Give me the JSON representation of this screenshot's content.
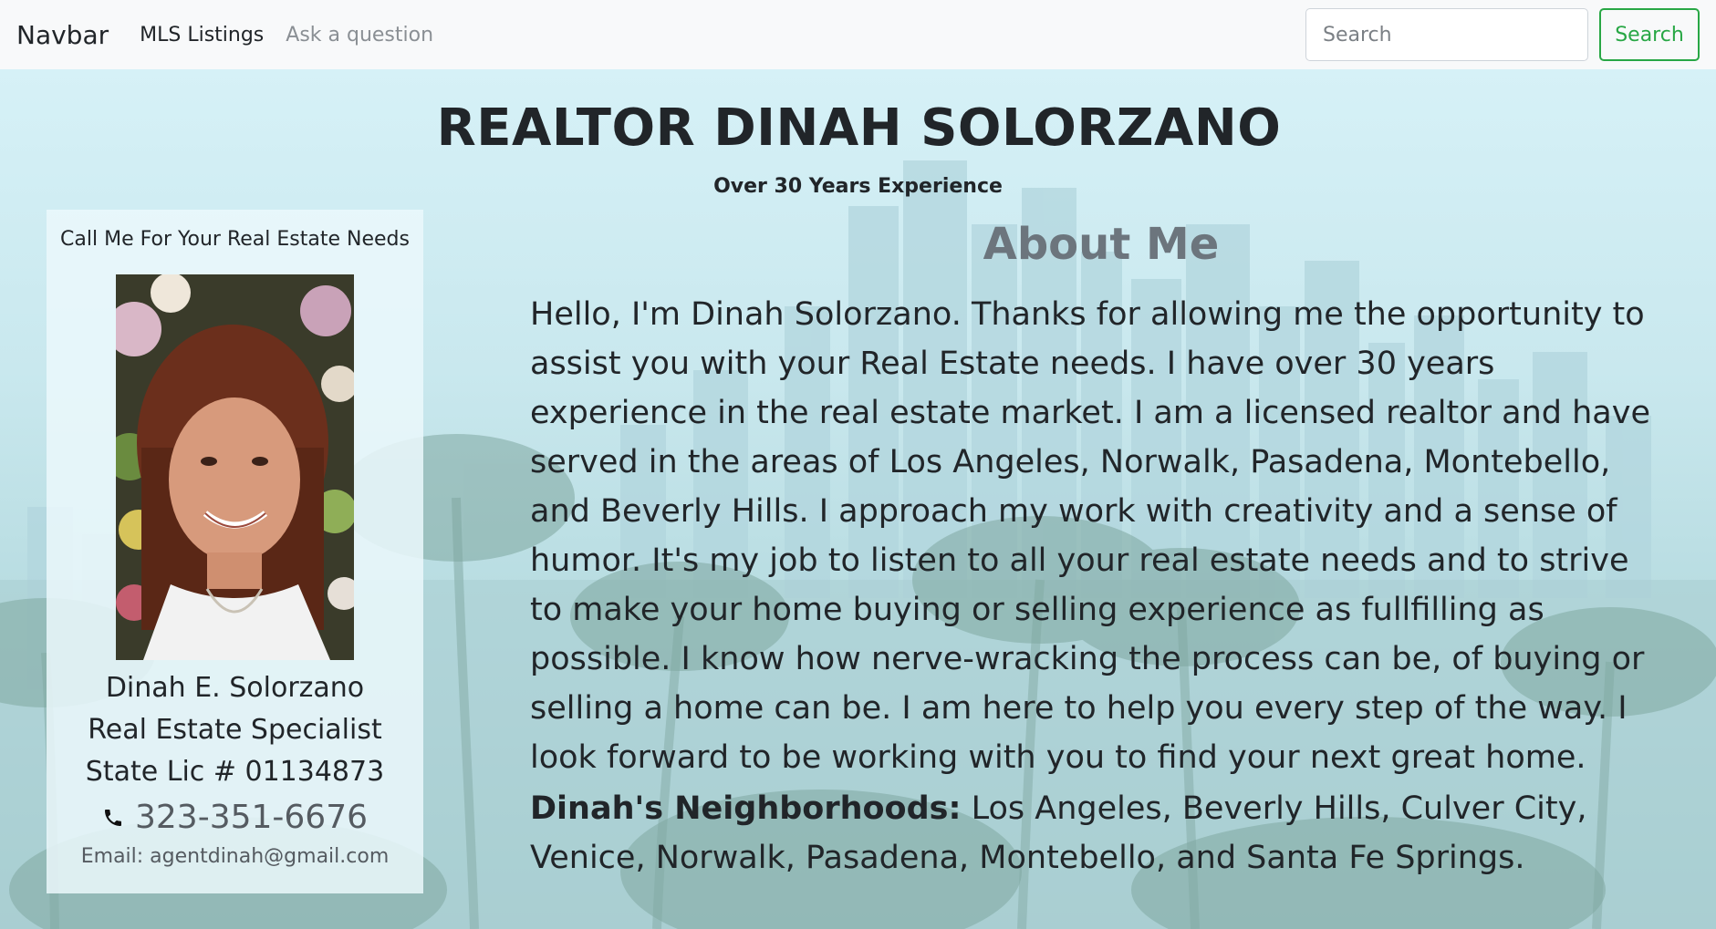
{
  "navbar": {
    "brand": "Navbar",
    "links": [
      {
        "label": "MLS Listings"
      },
      {
        "label": "Ask a question"
      }
    ],
    "search": {
      "placeholder": "Search",
      "button_label": "Search"
    }
  },
  "header": {
    "title": "REALTOR DINAH SOLORZANO",
    "subtitle": "Over 30 Years Experience"
  },
  "card": {
    "header": "Call Me For Your Real Estate Needs",
    "photo_alt": "Dinah E. Solorzano",
    "name": "Dinah E. Solorzano",
    "role": "Real Estate Specialist",
    "license": "State Lic # 01134873",
    "phone_icon": "phone-icon",
    "phone": "323-351-6676",
    "email": "Email: agentdinah@gmail.com"
  },
  "about": {
    "title": "About Me",
    "body": "Hello, I'm Dinah Solorzano. Thanks for allowing me the opportunity to assist you with your Real Estate needs. I have over 30 years experience in the real estate market. I am a licensed realtor and have served in the areas of Los Angeles, Norwalk, Pasadena, Montebello, and Beverly Hills. I approach my work with creativity and a sense of humor. It's my job to listen to all your real estate needs and to strive to make your home buying or selling experience as fullfilling as possible. I know how nerve-wracking the process can be, of buying or selling a home can be. I am here to help you every step of the way. I look forward to be working with you to find your next great home.",
    "neighborhoods_label": "Dinah's Neighborhoods:",
    "neighborhoods_value": "Los Angeles, Beverly Hills, Culver City, Venice, Norwalk, Pasadena, Montebello, and Santa Fe Springs."
  },
  "colors": {
    "accent_green": "#28a745",
    "navbar_bg": "#f8f9fa",
    "muted_text": "#6c757d"
  }
}
